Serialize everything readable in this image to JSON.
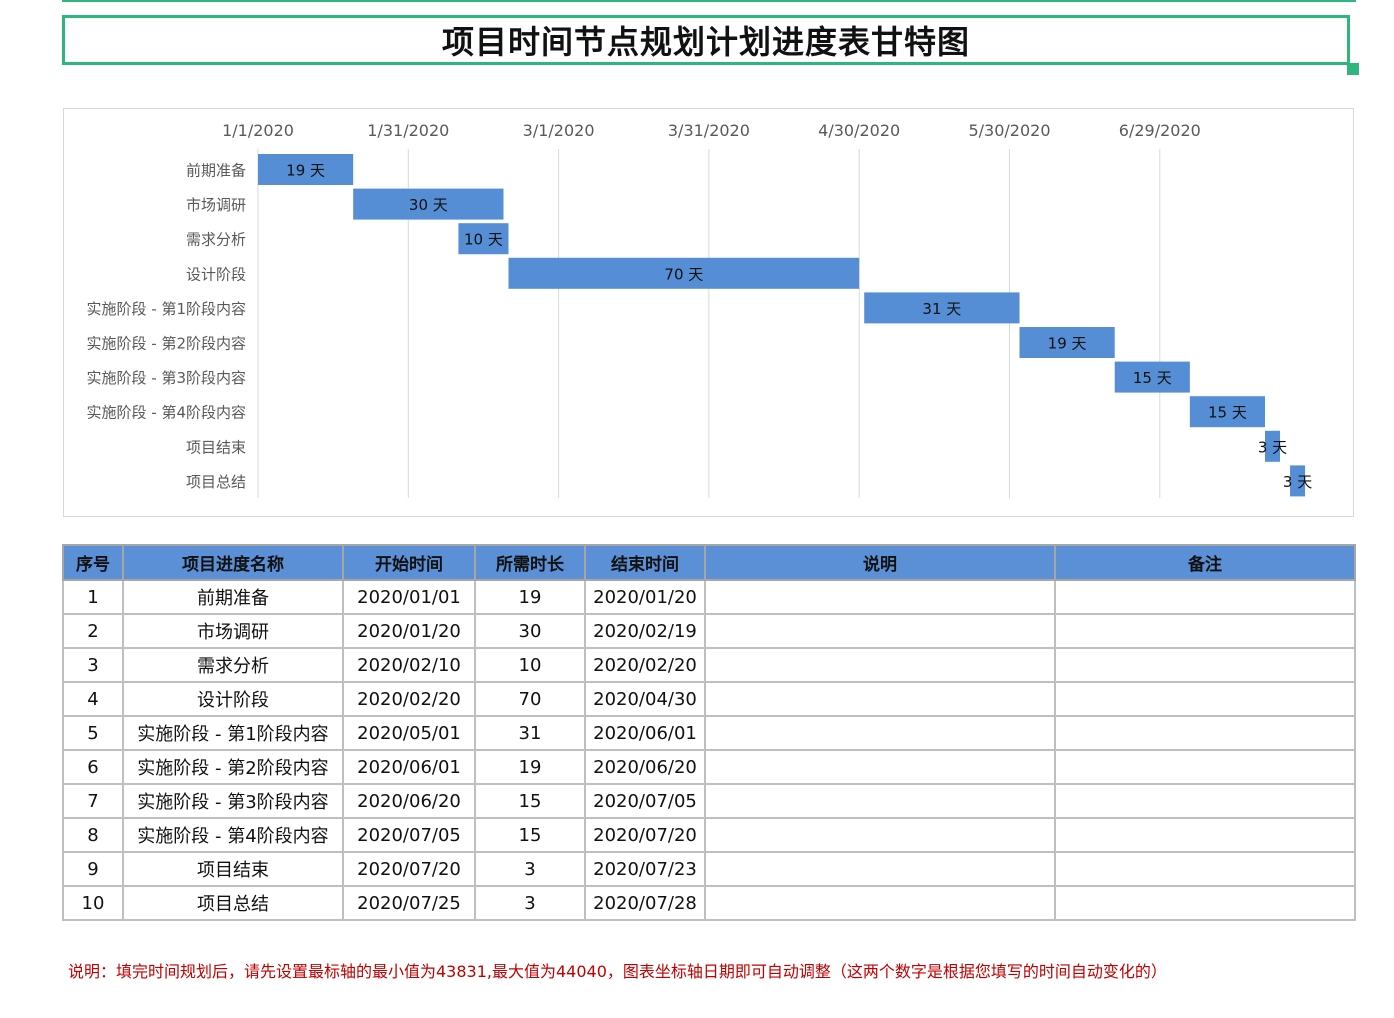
{
  "title": "项目时间节点规划计划进度表甘特图",
  "chart_data": {
    "type": "bar",
    "subtype": "gantt",
    "x_ticks": [
      "1/1/2020",
      "1/31/2020",
      "3/1/2020",
      "3/31/2020",
      "4/30/2020",
      "5/30/2020",
      "6/29/2020"
    ],
    "x_tick_days": [
      0,
      30,
      60,
      90,
      120,
      150,
      180
    ],
    "xlim": [
      0,
      209
    ],
    "grid": true,
    "bar_color": "#558ed5",
    "tasks": [
      {
        "name": "前期准备",
        "start_day": 0,
        "duration": 19,
        "label": "19 天"
      },
      {
        "name": "市场调研",
        "start_day": 19,
        "duration": 30,
        "label": "30 天"
      },
      {
        "name": "需求分析",
        "start_day": 40,
        "duration": 10,
        "label": "10 天"
      },
      {
        "name": "设计阶段",
        "start_day": 50,
        "duration": 70,
        "label": "70 天"
      },
      {
        "name": "实施阶段 - 第1阶段内容",
        "start_day": 121,
        "duration": 31,
        "label": "31 天"
      },
      {
        "name": "实施阶段 - 第2阶段内容",
        "start_day": 152,
        "duration": 19,
        "label": "19 天"
      },
      {
        "name": "实施阶段 - 第3阶段内容",
        "start_day": 171,
        "duration": 15,
        "label": "15 天"
      },
      {
        "name": "实施阶段 - 第4阶段内容",
        "start_day": 186,
        "duration": 15,
        "label": "15 天"
      },
      {
        "name": "项目结束",
        "start_day": 201,
        "duration": 3,
        "label": "3 天"
      },
      {
        "name": "项目总结",
        "start_day": 206,
        "duration": 3,
        "label": "3 天"
      }
    ]
  },
  "table": {
    "headers": [
      "序号",
      "项目进度名称",
      "开始时间",
      "所需时长",
      "结束时间",
      "说明",
      "备注"
    ],
    "rows": [
      [
        "1",
        "前期准备",
        "2020/01/01",
        "19",
        "2020/01/20",
        "",
        ""
      ],
      [
        "2",
        "市场调研",
        "2020/01/20",
        "30",
        "2020/02/19",
        "",
        ""
      ],
      [
        "3",
        "需求分析",
        "2020/02/10",
        "10",
        "2020/02/20",
        "",
        ""
      ],
      [
        "4",
        "设计阶段",
        "2020/02/20",
        "70",
        "2020/04/30",
        "",
        ""
      ],
      [
        "5",
        "实施阶段 - 第1阶段内容",
        "2020/05/01",
        "31",
        "2020/06/01",
        "",
        ""
      ],
      [
        "6",
        "实施阶段 - 第2阶段内容",
        "2020/06/01",
        "19",
        "2020/06/20",
        "",
        ""
      ],
      [
        "7",
        "实施阶段 - 第3阶段内容",
        "2020/06/20",
        "15",
        "2020/07/05",
        "",
        ""
      ],
      [
        "8",
        "实施阶段 - 第4阶段内容",
        "2020/07/05",
        "15",
        "2020/07/20",
        "",
        ""
      ],
      [
        "9",
        "项目结束",
        "2020/07/20",
        "3",
        "2020/07/23",
        "",
        ""
      ],
      [
        "10",
        "项目总结",
        "2020/07/25",
        "3",
        "2020/07/28",
        "",
        ""
      ]
    ]
  },
  "note": "说明：填完时间规划后，请先设置最标轴的最小值为43831,最大值为44040，图表坐标轴日期即可自动调整（这两个数字是根据您填写的时间自动变化的）",
  "colors": {
    "accent_green": "#2eb67d",
    "header_blue": "#5b8fd6",
    "bar_blue": "#558ed5",
    "note_red": "#c00000"
  }
}
